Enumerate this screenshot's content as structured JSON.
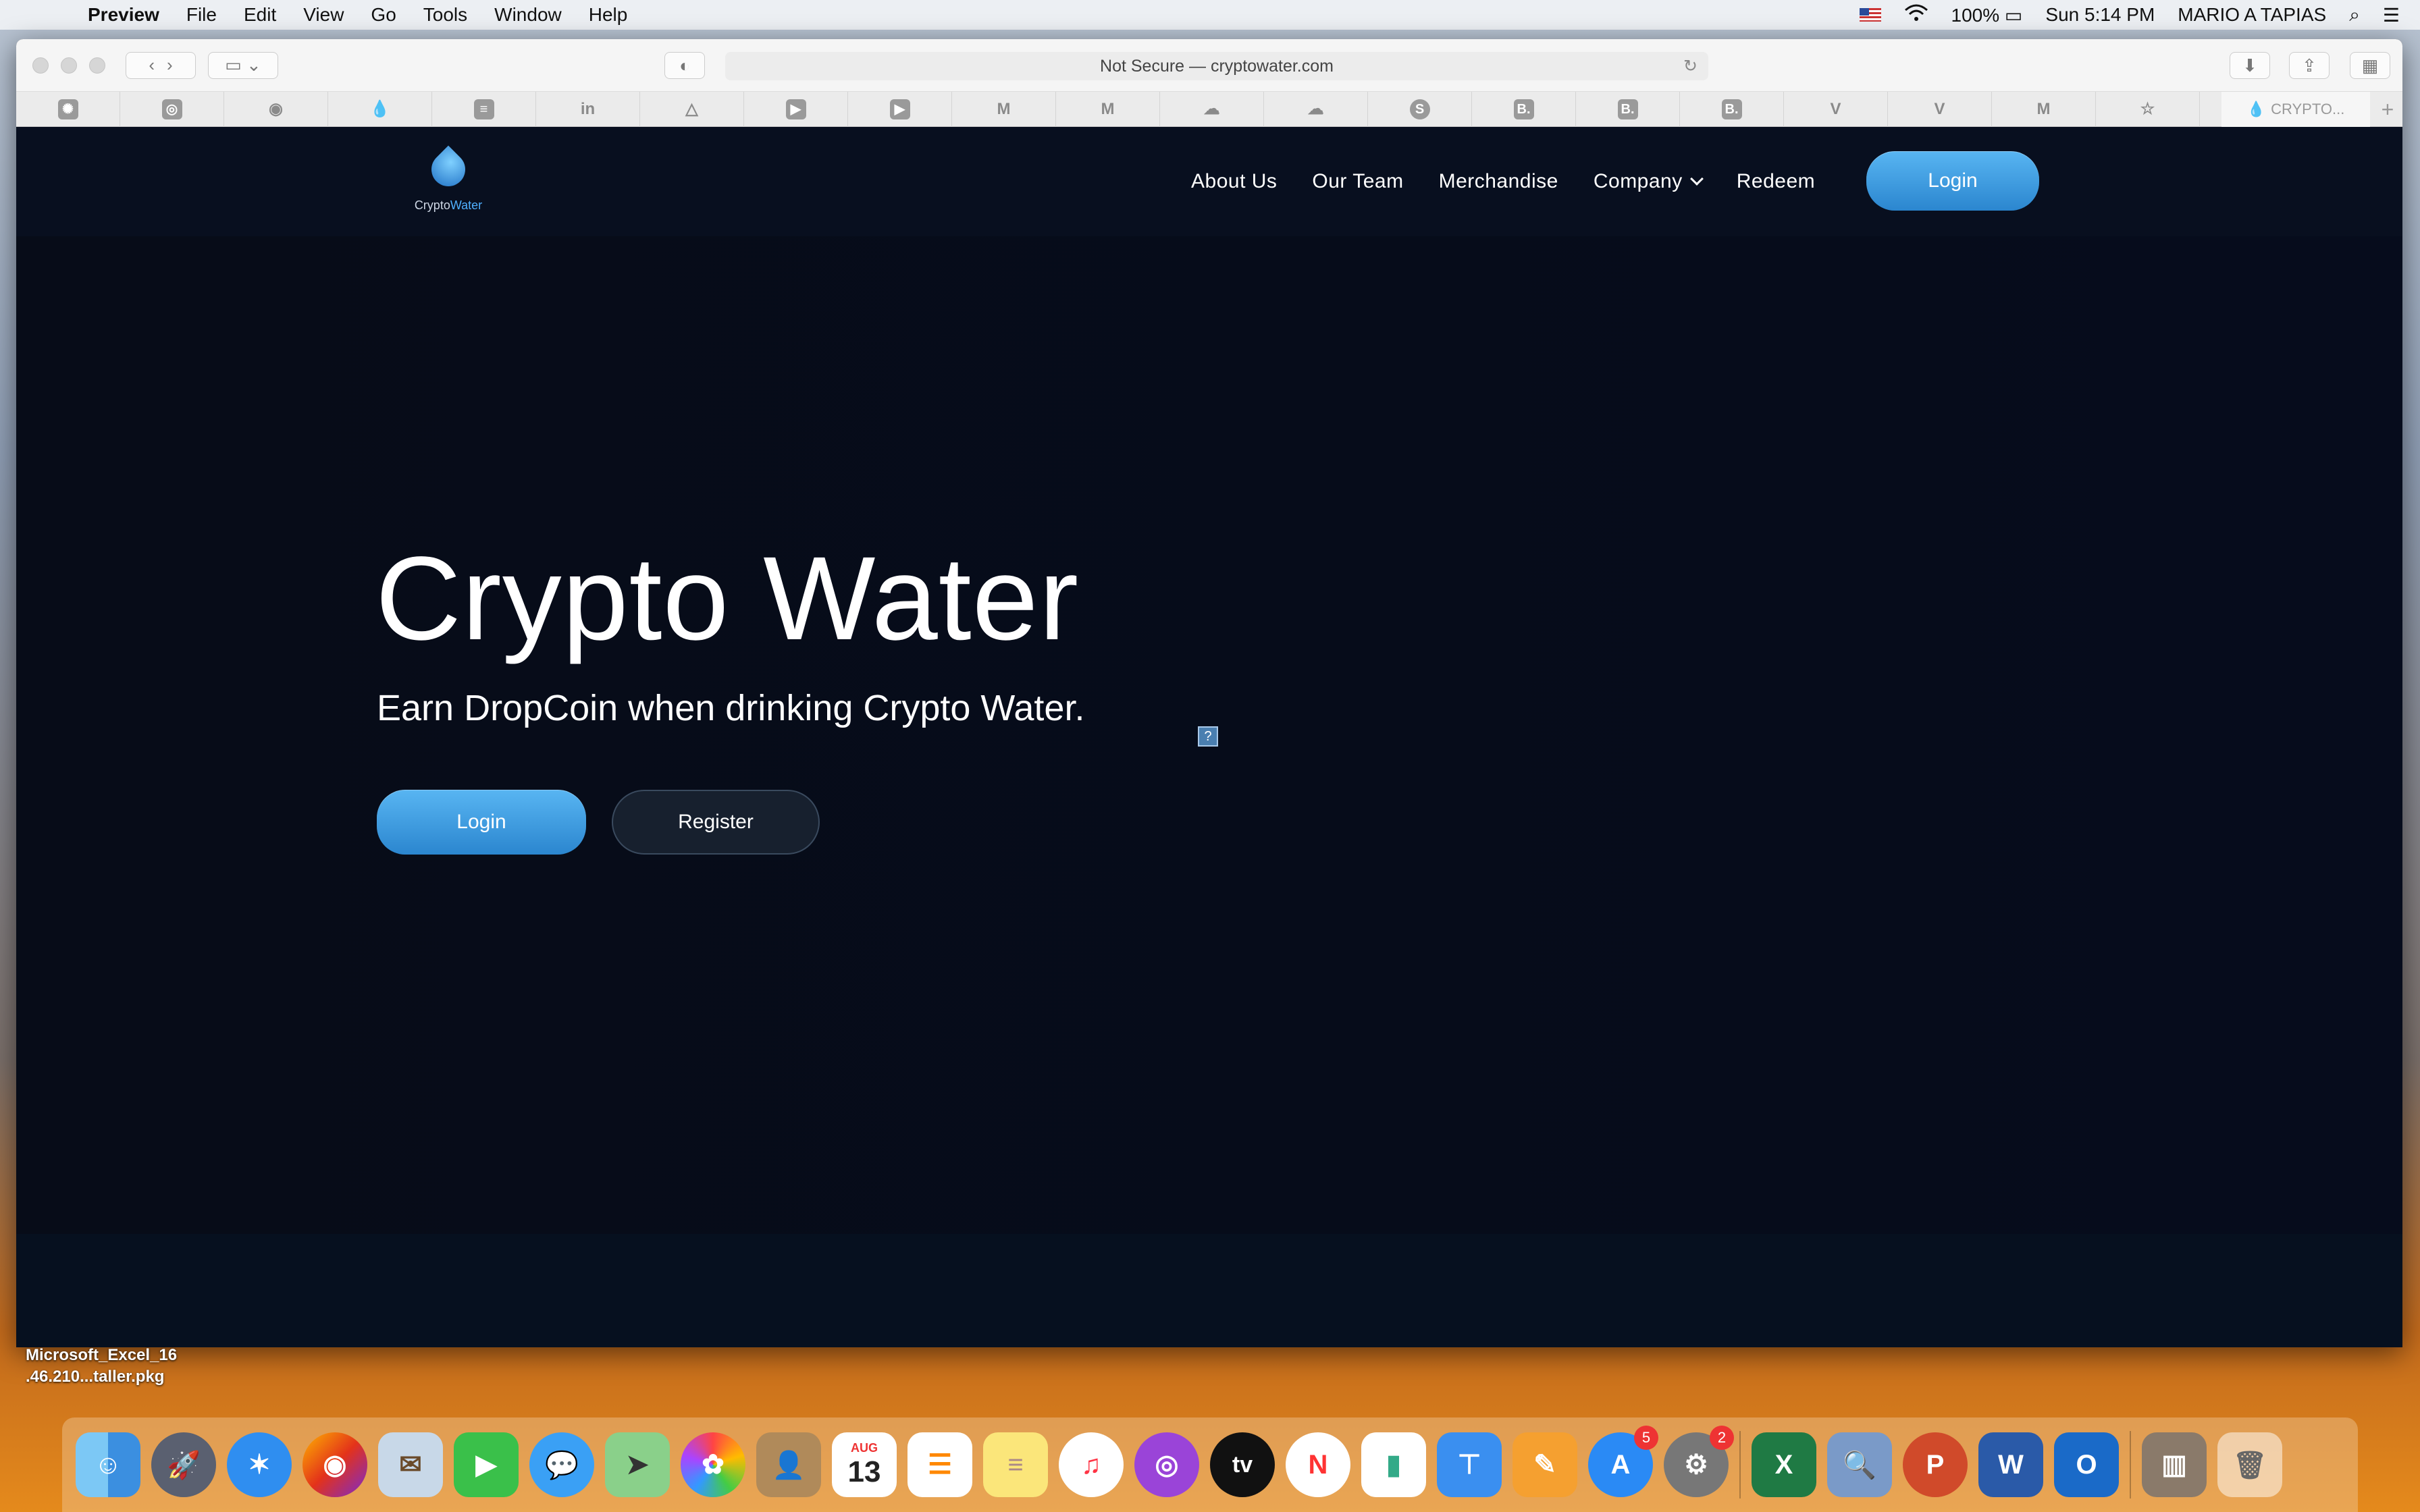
{
  "menubar": {
    "app_name": "Preview",
    "items": [
      "File",
      "Edit",
      "View",
      "Go",
      "Tools",
      "Window",
      "Help"
    ],
    "battery": "100%",
    "clock": "Sun 5:14 PM",
    "user": "MARIO A TAPIAS"
  },
  "browser": {
    "url_text": "Not Secure — cryptowater.com",
    "current_tab": "CRYPTO..."
  },
  "site": {
    "logo_text_a": "Crypto",
    "logo_text_b": "Water",
    "nav": {
      "about": "About Us",
      "team": "Our Team",
      "merch": "Merchandise",
      "company": "Company",
      "redeem": "Redeem",
      "login": "Login"
    },
    "hero": {
      "title": "Crypto Water",
      "subtitle": "Earn DropCoin when drinking Crypto Water.",
      "login": "Login",
      "register": "Register",
      "help_glyph": "?"
    }
  },
  "desktop": {
    "file_line1": "Microsoft_Excel_16",
    "file_line2": ".46.210...taller.pkg"
  },
  "dock": {
    "calendar_month": "AUG",
    "calendar_day": "13",
    "appstore_badge": "5",
    "settings_badge": "2",
    "tv_label": "tv"
  },
  "colors": {
    "page_bg": "#060d1c",
    "accent_blue": "#3d9de0"
  }
}
